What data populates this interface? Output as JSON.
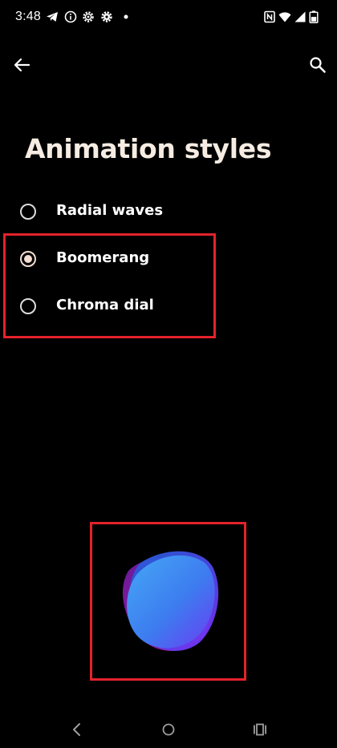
{
  "status_bar": {
    "time": "3:48",
    "left_icons": [
      "telegram-icon",
      "info-icon",
      "settings-outline-icon",
      "settings-icon",
      "dot-icon"
    ],
    "right_icons": [
      "nfc-icon",
      "wifi-icon",
      "signal-icon",
      "battery-icon"
    ]
  },
  "app_bar": {
    "back_icon": "arrow-back-icon",
    "search_icon": "search-icon"
  },
  "page": {
    "title": "Animation styles"
  },
  "options": [
    {
      "label": "Radial waves",
      "selected": false
    },
    {
      "label": "Boomerang",
      "selected": true
    },
    {
      "label": "Chroma dial",
      "selected": false
    }
  ],
  "nav_bar": {
    "back_icon": "nav-back-icon",
    "home_icon": "nav-home-icon",
    "recents_icon": "nav-recents-icon"
  },
  "colors": {
    "background": "#000000",
    "title": "#f6ece2",
    "radio_accent": "#f3dcd0",
    "highlight": "#e3222b"
  }
}
